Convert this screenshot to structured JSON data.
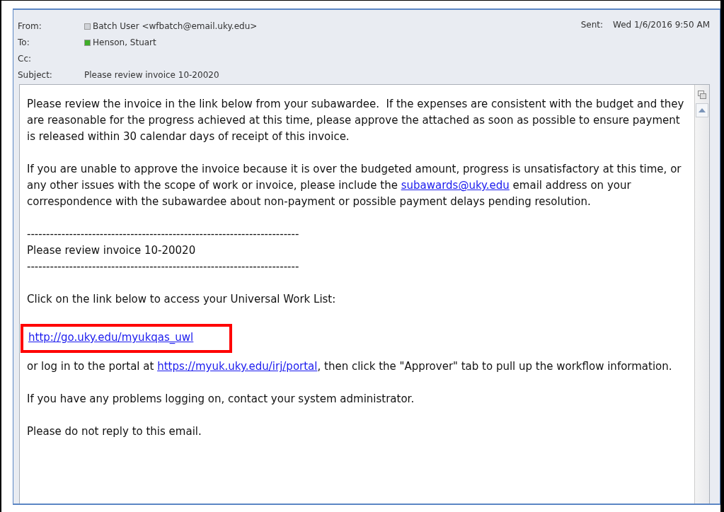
{
  "header": {
    "fields": [
      {
        "label": "From:",
        "value": "Batch User <wfbatch@email.uky.edu>",
        "color": "#d0d3d8"
      },
      {
        "label": "To:",
        "value": "Henson, Stuart",
        "color": "#3fae29"
      },
      {
        "label": "Cc:"
      },
      {
        "label": "Subject:",
        "value": "Please review invoice 10-20020"
      }
    ],
    "sent": {
      "label": "Sent:",
      "value": "Wed 1/6/2016 9:50 AM"
    }
  },
  "body": [
    {
      "kind": "paragraph",
      "parts": [
        {
          "text": "Please review the invoice in the link below from your subawardee.  If the expenses are consistent with the budget and they are reasonable for the progress achieved at this time, please approve the attached as soon as possible to ensure payment is released within 30 calendar days of receipt of this invoice."
        }
      ]
    },
    {
      "kind": "paragraph",
      "parts": [
        {
          "text": "If you are unable to approve the invoice because it is over the budgeted amount, progress is unsatisfactory at this time, or any other issues with the scope of work or invoice, please include the "
        },
        {
          "text": "subawards@uky.edu",
          "link": true
        },
        {
          "text": " email address on your correspondence with the subawardee about non-payment or possible payment delays pending resolution."
        }
      ]
    },
    {
      "kind": "line",
      "text": "-----------------------------------------------------------------------"
    },
    {
      "kind": "line",
      "text": "Please review invoice 10-20020"
    },
    {
      "kind": "line",
      "text": "-----------------------------------------------------------------------"
    },
    {
      "kind": "paragraph",
      "parts": [
        {
          "text": "Click on the link below to access your Universal Work List:"
        }
      ]
    },
    {
      "kind": "highlighted_link",
      "text": "http://go.uky.edu/myukqas_uwl"
    },
    {
      "kind": "paragraph",
      "parts": [
        {
          "text": "or log in to the portal at "
        },
        {
          "text": "https://myuk.uky.edu/irj/portal",
          "link": true
        },
        {
          "text": ", then click the \"Approver\" tab to pull up the workflow information."
        }
      ]
    },
    {
      "kind": "paragraph",
      "parts": [
        {
          "text": "If you have any problems logging on, contact your system administrator."
        }
      ]
    },
    {
      "kind": "paragraph",
      "parts": [
        {
          "text": "Please do not reply to this email."
        }
      ]
    }
  ]
}
